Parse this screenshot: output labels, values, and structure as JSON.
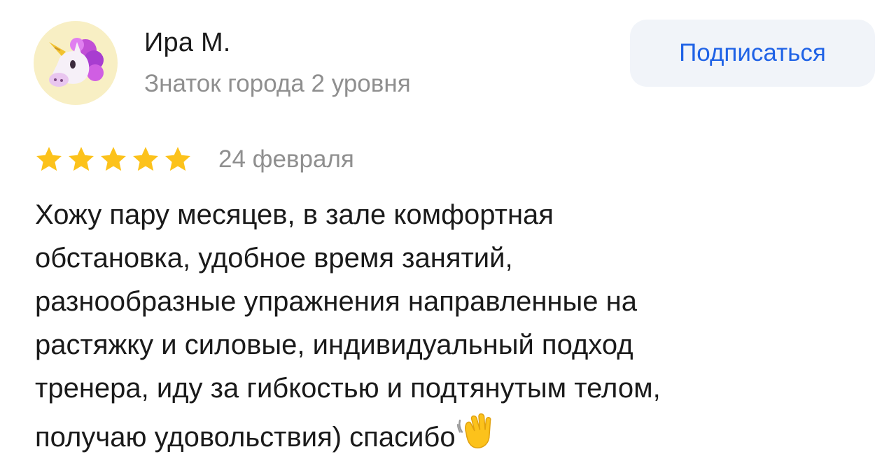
{
  "author": {
    "name": "Ира М.",
    "level": "Знаток города 2 уровня",
    "avatar_icon": "unicorn-avatar-icon"
  },
  "actions": {
    "subscribe_label": "Подписаться"
  },
  "review": {
    "rating": 5,
    "rating_max": 5,
    "star_icon": "star-icon",
    "date": "24 февраля",
    "text": "Хожу пару месяцев, в зале комфортная\nобстановка, удобное время занятий,\nразнообразные упражнения направленные на\nрастяжку и силовые, индивидуальный подход\nтренера, иду за гибкостью и подтянутым телом,\nполучаю удовольствия) спасибо",
    "trailing_icon": "waving-hand-icon"
  },
  "colors": {
    "accent": "#1f62e6",
    "star": "#fcc21b",
    "muted_text": "#8f8f8f",
    "button_bg": "#f1f4f9",
    "avatar_bg": "#f8efc4"
  }
}
